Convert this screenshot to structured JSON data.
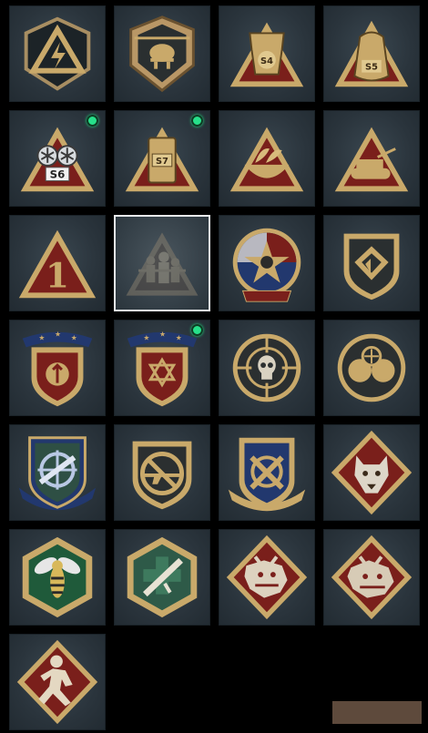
{
  "colors": {
    "gold": "#c9a96a",
    "gold_dark": "#8a6a38",
    "red": "#7a1f1b",
    "navy": "#22386e",
    "green_dot": "#27e08a"
  },
  "tiles": [
    {
      "icon": "lightning-triangle-emblem-icon",
      "new": false,
      "selected": false
    },
    {
      "icon": "helicopter-shield-emblem-icon",
      "new": false,
      "selected": false
    },
    {
      "icon": "s4-supply-drop-emblem-icon",
      "new": false,
      "selected": false,
      "label": "S4"
    },
    {
      "icon": "s5-supply-bag-emblem-icon",
      "new": false,
      "selected": false,
      "label": "S5"
    },
    {
      "icon": "s6-goggles-emblem-icon",
      "new": true,
      "selected": false,
      "label": "S6"
    },
    {
      "icon": "s7-crate-emblem-icon",
      "new": true,
      "selected": false,
      "label": "S7"
    },
    {
      "icon": "bowl-leaf-triangle-emblem-icon",
      "new": false,
      "selected": false
    },
    {
      "icon": "tank-triangle-emblem-icon",
      "new": false,
      "selected": false
    },
    {
      "icon": "number-one-triangle-emblem-icon",
      "new": false,
      "selected": false,
      "label": "1"
    },
    {
      "icon": "soldiers-triangle-emblem-icon",
      "new": false,
      "selected": true
    },
    {
      "icon": "star-skull-shield-emblem-icon",
      "new": false,
      "selected": false
    },
    {
      "icon": "chevron-shield-emblem-icon",
      "new": false,
      "selected": false
    },
    {
      "icon": "blue-banner-crest-emblem-icon",
      "new": false,
      "selected": false
    },
    {
      "icon": "hexagram-crest-emblem-icon",
      "new": true,
      "selected": false
    },
    {
      "icon": "crosshair-skull-emblem-icon",
      "new": false,
      "selected": false
    },
    {
      "icon": "crosshair-fists-emblem-icon",
      "new": false,
      "selected": false
    },
    {
      "icon": "crosshair-rifle-shield-emblem-icon",
      "new": false,
      "selected": false
    },
    {
      "icon": "no-rifle-shield-emblem-icon",
      "new": false,
      "selected": false
    },
    {
      "icon": "crossed-tools-shield-emblem-icon",
      "new": false,
      "selected": false
    },
    {
      "icon": "wolf-diamond-emblem-icon",
      "new": false,
      "selected": false
    },
    {
      "icon": "hornet-hexagon-emblem-icon",
      "new": false,
      "selected": false
    },
    {
      "icon": "medic-rifle-hexagon-emblem-icon",
      "new": false,
      "selected": false
    },
    {
      "icon": "dragon-diamond-emblem-icon",
      "new": false,
      "selected": false
    },
    {
      "icon": "dragon-diamond-alt-emblem-icon",
      "new": false,
      "selected": false
    },
    {
      "icon": "runner-diamond-emblem-icon",
      "new": false,
      "selected": false
    }
  ]
}
